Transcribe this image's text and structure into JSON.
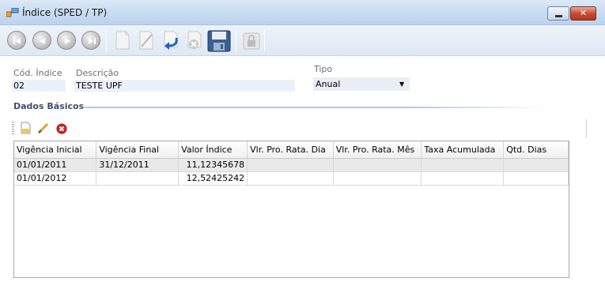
{
  "window": {
    "title": "Índice (SPED / TP)"
  },
  "form": {
    "cod_indice": {
      "label": "Cód. Índice",
      "value": "02"
    },
    "descricao": {
      "label": "Descrição",
      "value": "TESTE UPF"
    },
    "tipo": {
      "label": "Tipo",
      "value": "Anual"
    }
  },
  "group": {
    "title": "Dados Básicos"
  },
  "grid": {
    "columns": [
      "Vigência Inicial",
      "Vigência Final",
      "Valor Índice",
      "Vlr. Pro. Rata. Dia",
      "Vlr. Pro. Rata. Mês",
      "Taxa Acumulada",
      "Qtd. Dias"
    ],
    "rows": [
      [
        "01/01/2011",
        "31/12/2011",
        "11,12345678",
        "",
        "",
        "",
        ""
      ],
      [
        "01/01/2012",
        "",
        "12,52425242",
        "",
        "",
        "",
        ""
      ]
    ]
  },
  "colors": {
    "titlebar": "#c9dcf1",
    "close_button": "#c4452c",
    "group_title": "#3e4f6e",
    "label": "#6b6b7b",
    "selected_row": "#e9e9e9"
  },
  "icons": {
    "window": "app-window-icon",
    "first": "first-record-icon",
    "prev": "previous-record-icon",
    "next": "next-record-icon",
    "last": "last-record-icon",
    "new": "new-document-icon",
    "edit": "edit-pencil-icon",
    "undo": "undo-arrow-icon",
    "delete": "delete-icon",
    "save": "save-disk-icon",
    "lock": "lock-icon"
  }
}
